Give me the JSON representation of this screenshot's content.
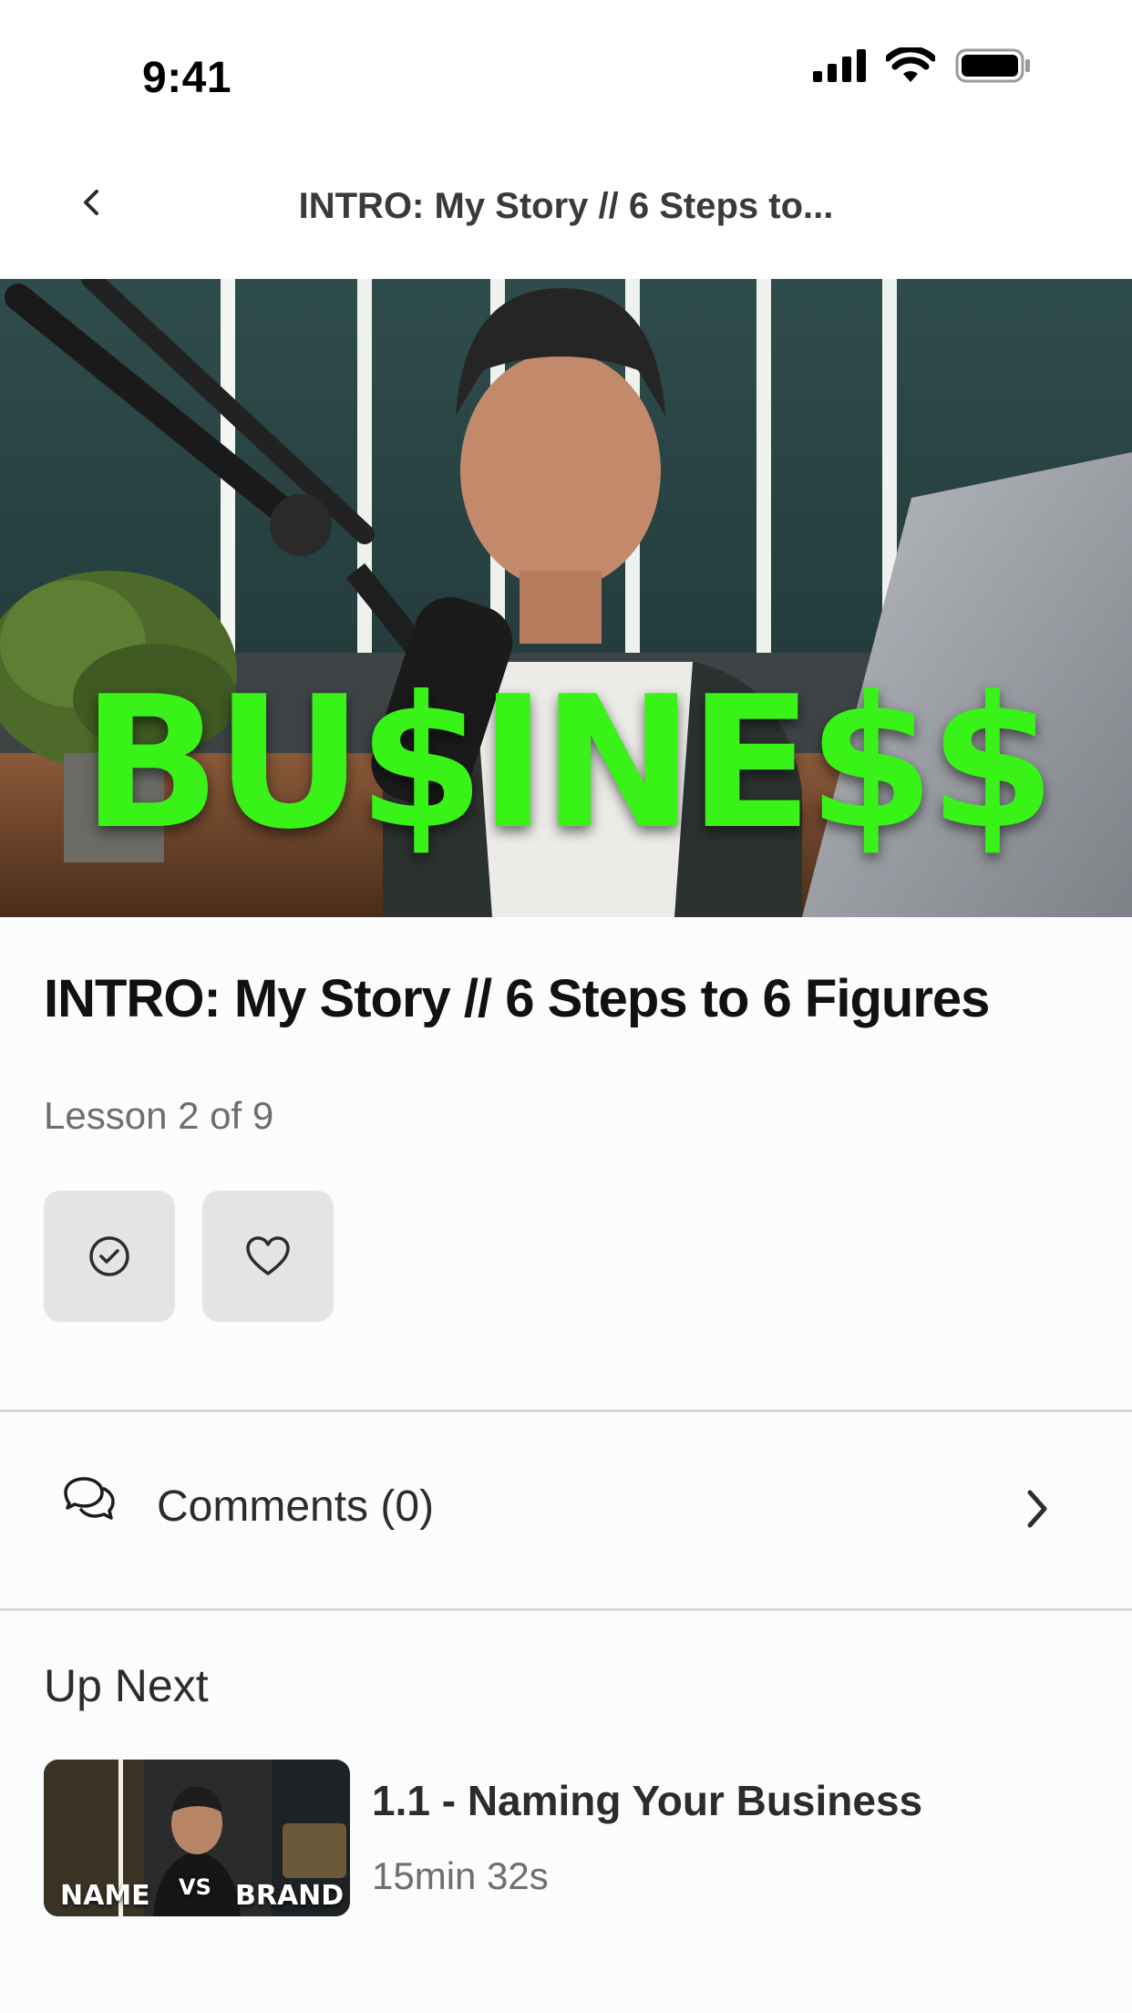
{
  "status_bar": {
    "time": "9:41"
  },
  "nav": {
    "title": "INTRO: My Story // 6 Steps to..."
  },
  "video": {
    "overlay_text": "BU$INE$$"
  },
  "lesson": {
    "title": "INTRO: My Story // 6 Steps to 6 Figures",
    "progress": "Lesson 2 of 9"
  },
  "actions": {
    "complete_icon": "check-circle-icon",
    "favorite_icon": "heart-icon"
  },
  "comments": {
    "label": "Comments (0)"
  },
  "up_next": {
    "heading": "Up Next",
    "items": [
      {
        "title": "1.1 - Naming Your Business",
        "duration": "15min 32s",
        "thumb_left": "NAME",
        "thumb_mid": "VS",
        "thumb_right": "BRAND"
      }
    ]
  },
  "colors": {
    "accent_green": "#39f218",
    "button_bg": "#e4e3e6",
    "divider": "#d6d6d9"
  }
}
